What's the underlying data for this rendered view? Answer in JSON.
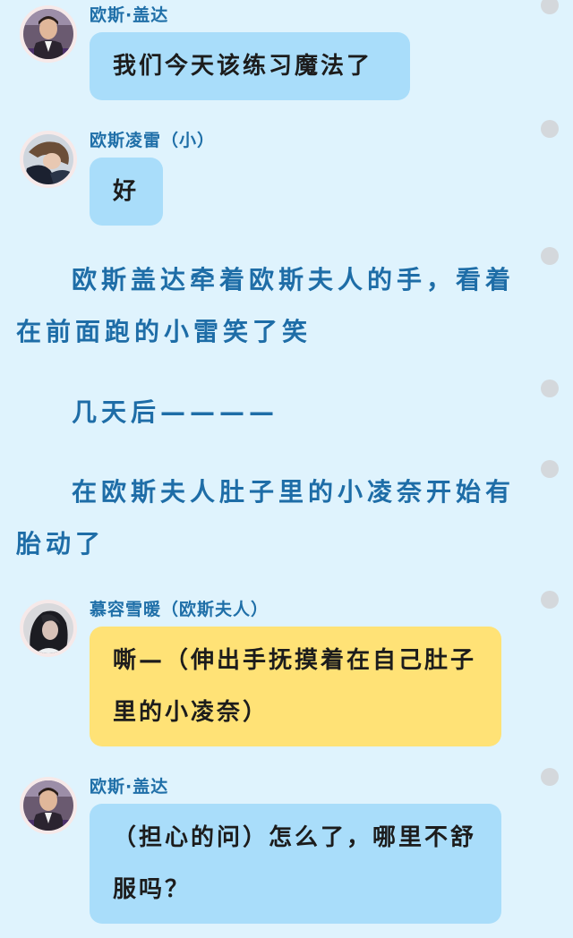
{
  "messages": [
    {
      "speaker": "欧斯·盖达",
      "text": "我们今天该练习魔法了"
    },
    {
      "speaker": "欧斯凌雷（小）",
      "text": "好"
    },
    {
      "speaker": "慕容雪暖（欧斯夫人）",
      "text": "嘶—（伸出手抚摸着在自己肚子里的小凌奈）"
    },
    {
      "speaker": "欧斯·盖达",
      "text": "（担心的问）怎么了，哪里不舒服吗？"
    }
  ],
  "narration": [
    "欧斯盖达牵着欧斯夫人的手，看着在前面跑的小雷笑了笑",
    "几天后————",
    "在欧斯夫人肚子里的小凌奈开始有胎动了"
  ],
  "colors": {
    "background": "#dff3fd",
    "bubble_blue": "#a9ddfa",
    "bubble_yellow": "#ffe276",
    "name_text": "#1f6fa8",
    "narration_text": "#1e6da7"
  },
  "icons": {
    "avatar_gaida": "avatar-man-suit",
    "avatar_linglei": "avatar-child",
    "avatar_xuenuan": "avatar-woman",
    "side_dot": "circle-dot"
  }
}
